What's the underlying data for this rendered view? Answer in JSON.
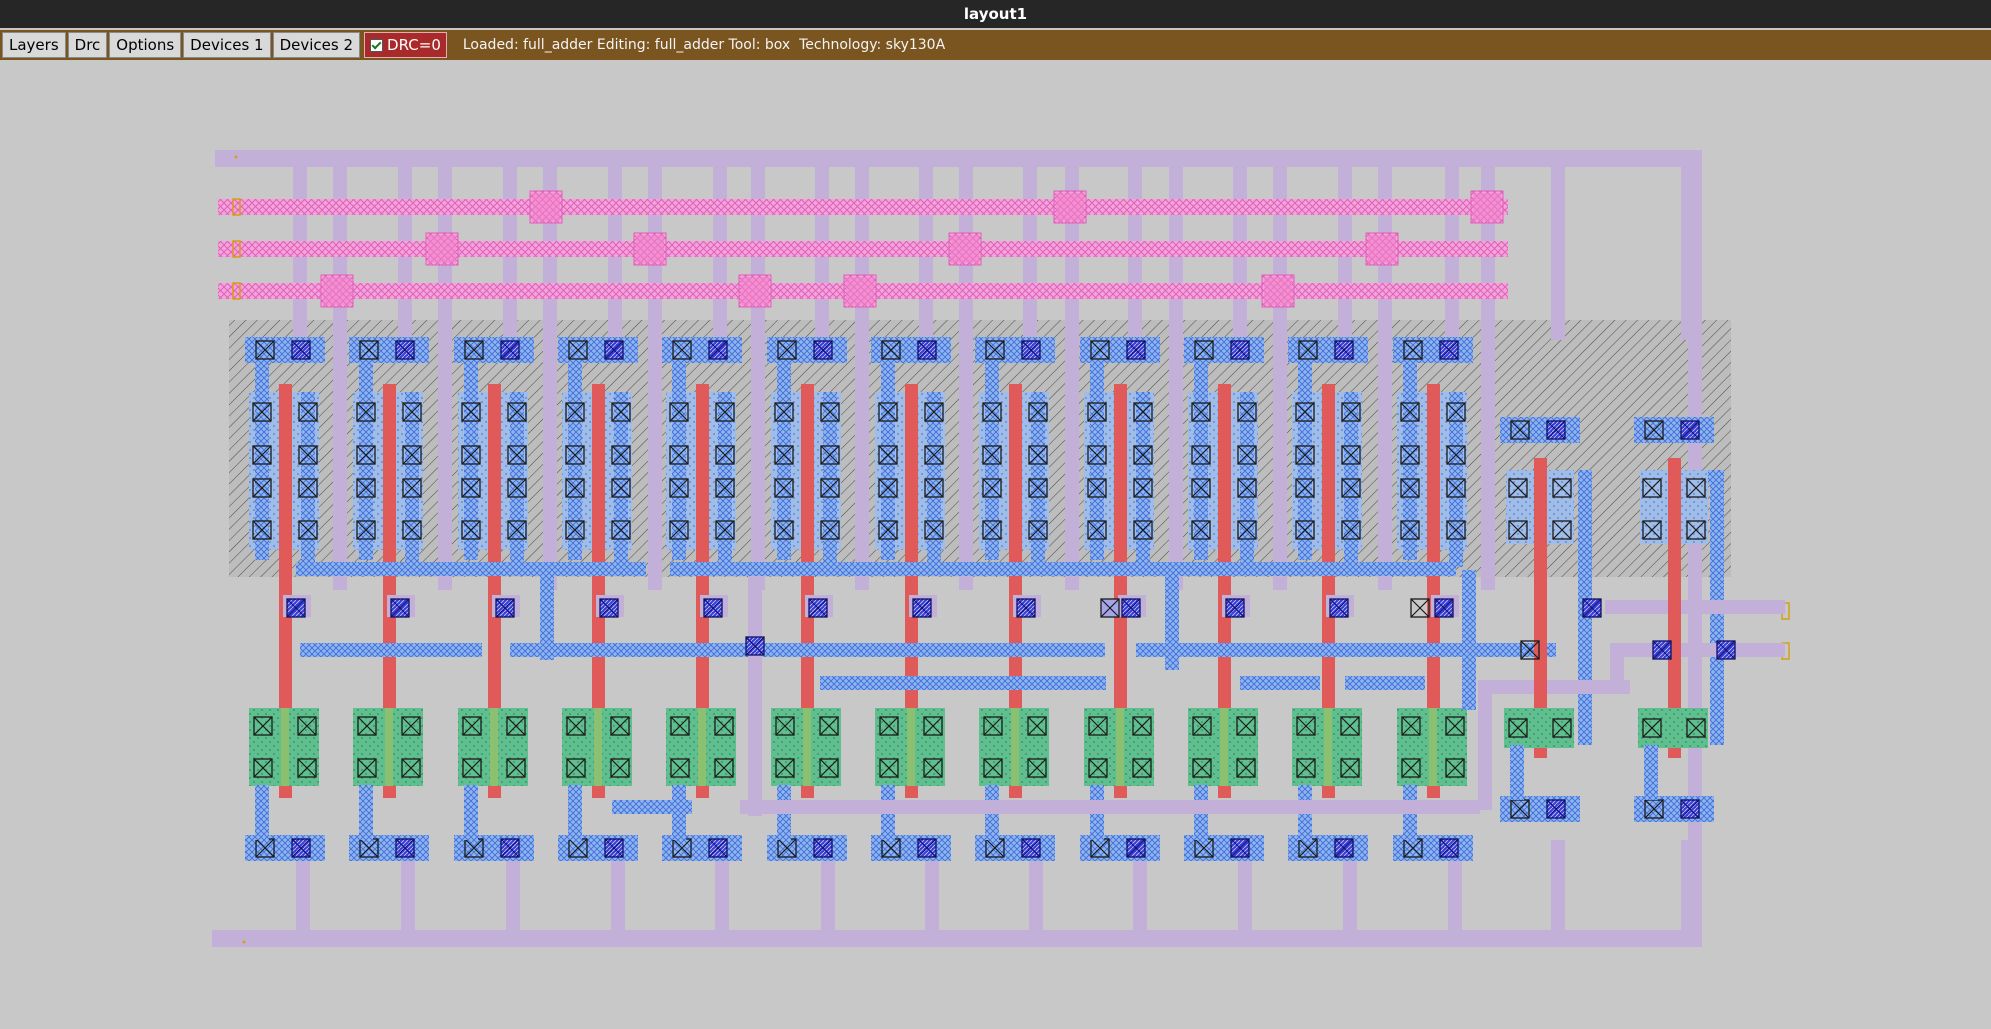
{
  "window": {
    "title": "layout1"
  },
  "toolbar": {
    "buttons": [
      "Layers",
      "Drc",
      "Options",
      "Devices 1",
      "Devices 2"
    ],
    "drc_label": "DRC=0",
    "drc_checked": true,
    "status": "Loaded: full_adder Editing: full_adder Tool: box  Technology: sky130A"
  },
  "layout": {
    "cell": "full_adder",
    "technology": "sky130A",
    "colors": {
      "background": "#c8c8c8",
      "metal1": "#c3b0d8",
      "poly": "#e05a5a",
      "local_interconnect": "#8fb4f0",
      "li_hatch": "#4a7ad8",
      "nwell_hatch": "#555555",
      "metal2": "#f28ad0",
      "diffusion_p": "#9fbde8",
      "diffusion_n": "#5fbf8f",
      "contact": "#1a1a1a",
      "via": "#2a2ad0"
    },
    "icons": [
      "contact-icon",
      "via-icon",
      "pin-label-icon"
    ]
  }
}
